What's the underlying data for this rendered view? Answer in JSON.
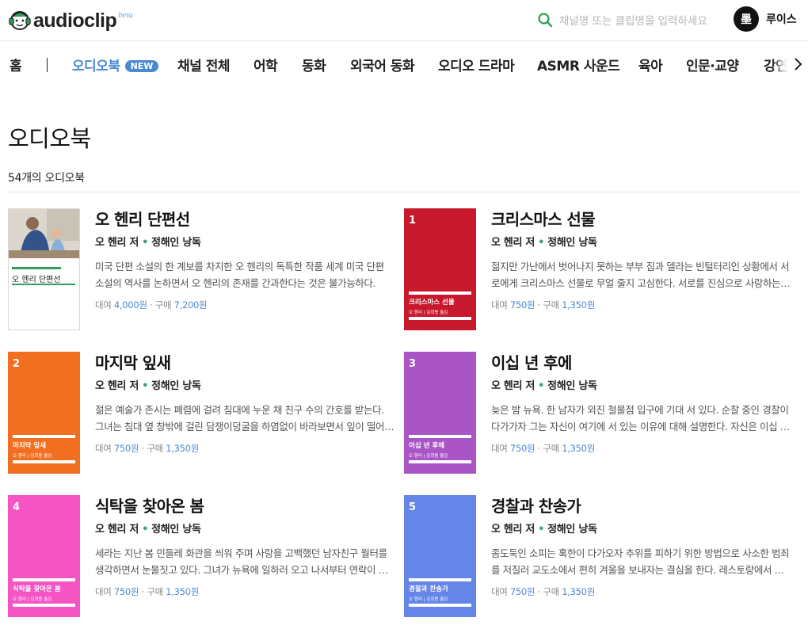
{
  "header": {
    "logo_text": "audioclip",
    "logo_beta": "beta",
    "search_placeholder": "채널명 또는 클립명을 입력하세요",
    "user_avatar_text": "墨",
    "user_name": "루이스"
  },
  "nav": {
    "home": "홈",
    "items": [
      "오디오북",
      "채널 전체",
      "어학",
      "동화",
      "외국어 동화",
      "오디오 드라마",
      "ASMR 사운드",
      "육아",
      "인문·교양",
      "강연"
    ],
    "new_badge": "NEW"
  },
  "page": {
    "title": "오디오북",
    "count": "54개의 오디오북"
  },
  "books": [
    {
      "title": "오 헨리 단편선",
      "author": "오 헨리 저",
      "narrator": "정해인 낭독",
      "desc": "미국 단편 소설의 한 계보를 차지한 오 헨리의 독특한 작품 세계 미국 단편 소설의 역사를 논하면서 오 헨리의 존재를 간과한다는 것은 불가능하다.",
      "rent_label": "대여",
      "rent_price": "4,000원",
      "buy_label": "구매",
      "buy_price": "7,200원",
      "cover_title": "오 헨리 단편선",
      "cover_number": "",
      "cover_sub": "",
      "cover_color": "#ffffff"
    },
    {
      "title": "크리스마스 선물",
      "author": "오 헨리 저",
      "narrator": "정해인 낭독",
      "desc": "젊지만 가난에서 벗어나지 못하는 부부 짐과 델라는 빈털터리인 상황에서 서로에게 크리스마스 선물로 무얼 줄지 고심한다. 서로를 진심으로 사랑하는 두 사람.",
      "rent_label": "대여",
      "rent_price": "750원",
      "buy_label": "구매",
      "buy_price": "1,350원",
      "cover_title": "크리스마스 선물",
      "cover_number": "1",
      "cover_sub": "오 헨리 | 김희용 옮김",
      "cover_color": "#c8182d"
    },
    {
      "title": "마지막 잎새",
      "author": "오 헨리 저",
      "narrator": "정해인 낭독",
      "desc": "젊은 예술가 존시는 폐렴에 걸려 침대에 누운 채 친구 수의 간호를 받는다. 그녀는 침대 옆 창밖에 걸린 담쟁이덩굴을 하염없이 바라보면서 잎이 떨어지기를 센다.",
      "rent_label": "대여",
      "rent_price": "750원",
      "buy_label": "구매",
      "buy_price": "1,350원",
      "cover_title": "마지막 잎새",
      "cover_number": "2",
      "cover_sub": "오 헨리 | 김희용 옮김",
      "cover_color": "#f26e21"
    },
    {
      "title": "이십 년 후에",
      "author": "오 헨리 저",
      "narrator": "정해인 낭독",
      "desc": "늦은 밤 뉴욕. 한 남자가 외진 철물점 입구에 기대 서 있다. 순찰 중인 경찰이 다가가자 그는 자신이 여기에 서 있는 이유에 대해 설명한다. 자신은 이십 년 전에.",
      "rent_label": "대여",
      "rent_price": "750원",
      "buy_label": "구매",
      "buy_price": "1,350원",
      "cover_title": "이십 년 후에",
      "cover_number": "3",
      "cover_sub": "오 헨리 | 김희용 옮김",
      "cover_color": "#a955c6"
    },
    {
      "title": "식탁을 찾아온 봄",
      "author": "오 헨리 저",
      "narrator": "정해인 낭독",
      "desc": "세라는 지난 봄 민들레 화관을 씌워 주며 사랑을 고백했던 남자친구 월터를 생각하면서 눈물짓고 있다. 그녀가 뉴욕에 일하러 오고 나서부터 연락이 끊겼다.",
      "rent_label": "대여",
      "rent_price": "750원",
      "buy_label": "구매",
      "buy_price": "1,350원",
      "cover_title": "식탁을 찾아온 봄",
      "cover_number": "4",
      "cover_sub": "오 헨리 | 김희용 옮김",
      "cover_color": "#f455c3"
    },
    {
      "title": "경찰과 찬송가",
      "author": "오 헨리 저",
      "narrator": "정해인 낭독",
      "desc": "좀도둑인 소피는 혹한이 다가오자 추위를 피하기 위한 방법으로 사소한 범죄를 저질러 교도소에서 편히 겨울을 보내자는 결심을 한다. 레스토랑에서 식사를 하고.",
      "rent_label": "대여",
      "rent_price": "750원",
      "buy_label": "구매",
      "buy_price": "1,350원",
      "cover_title": "경찰과 찬송가",
      "cover_number": "5",
      "cover_sub": "오 헨리 | 김희용 옮김",
      "cover_color": "#6585e9"
    }
  ]
}
